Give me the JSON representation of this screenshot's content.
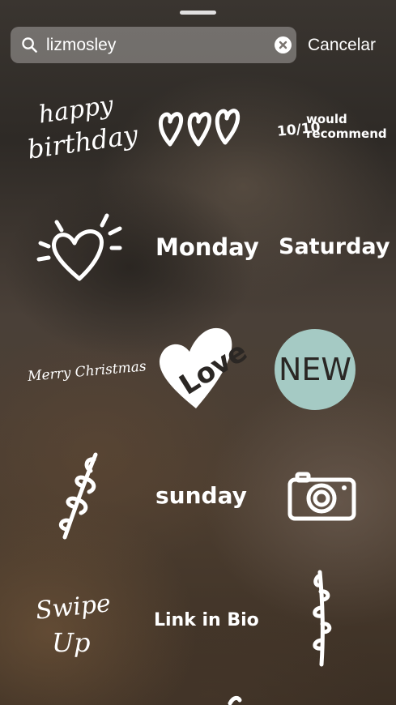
{
  "search": {
    "value": "lizmosley"
  },
  "cancel_label": "Cancelar",
  "stickers": {
    "happy_birthday": {
      "line1": "happy",
      "line2": "birthday"
    },
    "recommend": {
      "fraction": "10/10",
      "line1": "would",
      "line2": "recommend"
    },
    "monday": "Monday",
    "saturday": "Saturday",
    "merry_christmas": "Merry Christmas",
    "love": "Love",
    "new": "NEW",
    "sunday": "sunday",
    "swipe_up": {
      "line1": "Swipe",
      "line2": "Up"
    },
    "link_in_bio": "Link in Bio"
  },
  "colors": {
    "new_badge": "#a5cac4"
  }
}
